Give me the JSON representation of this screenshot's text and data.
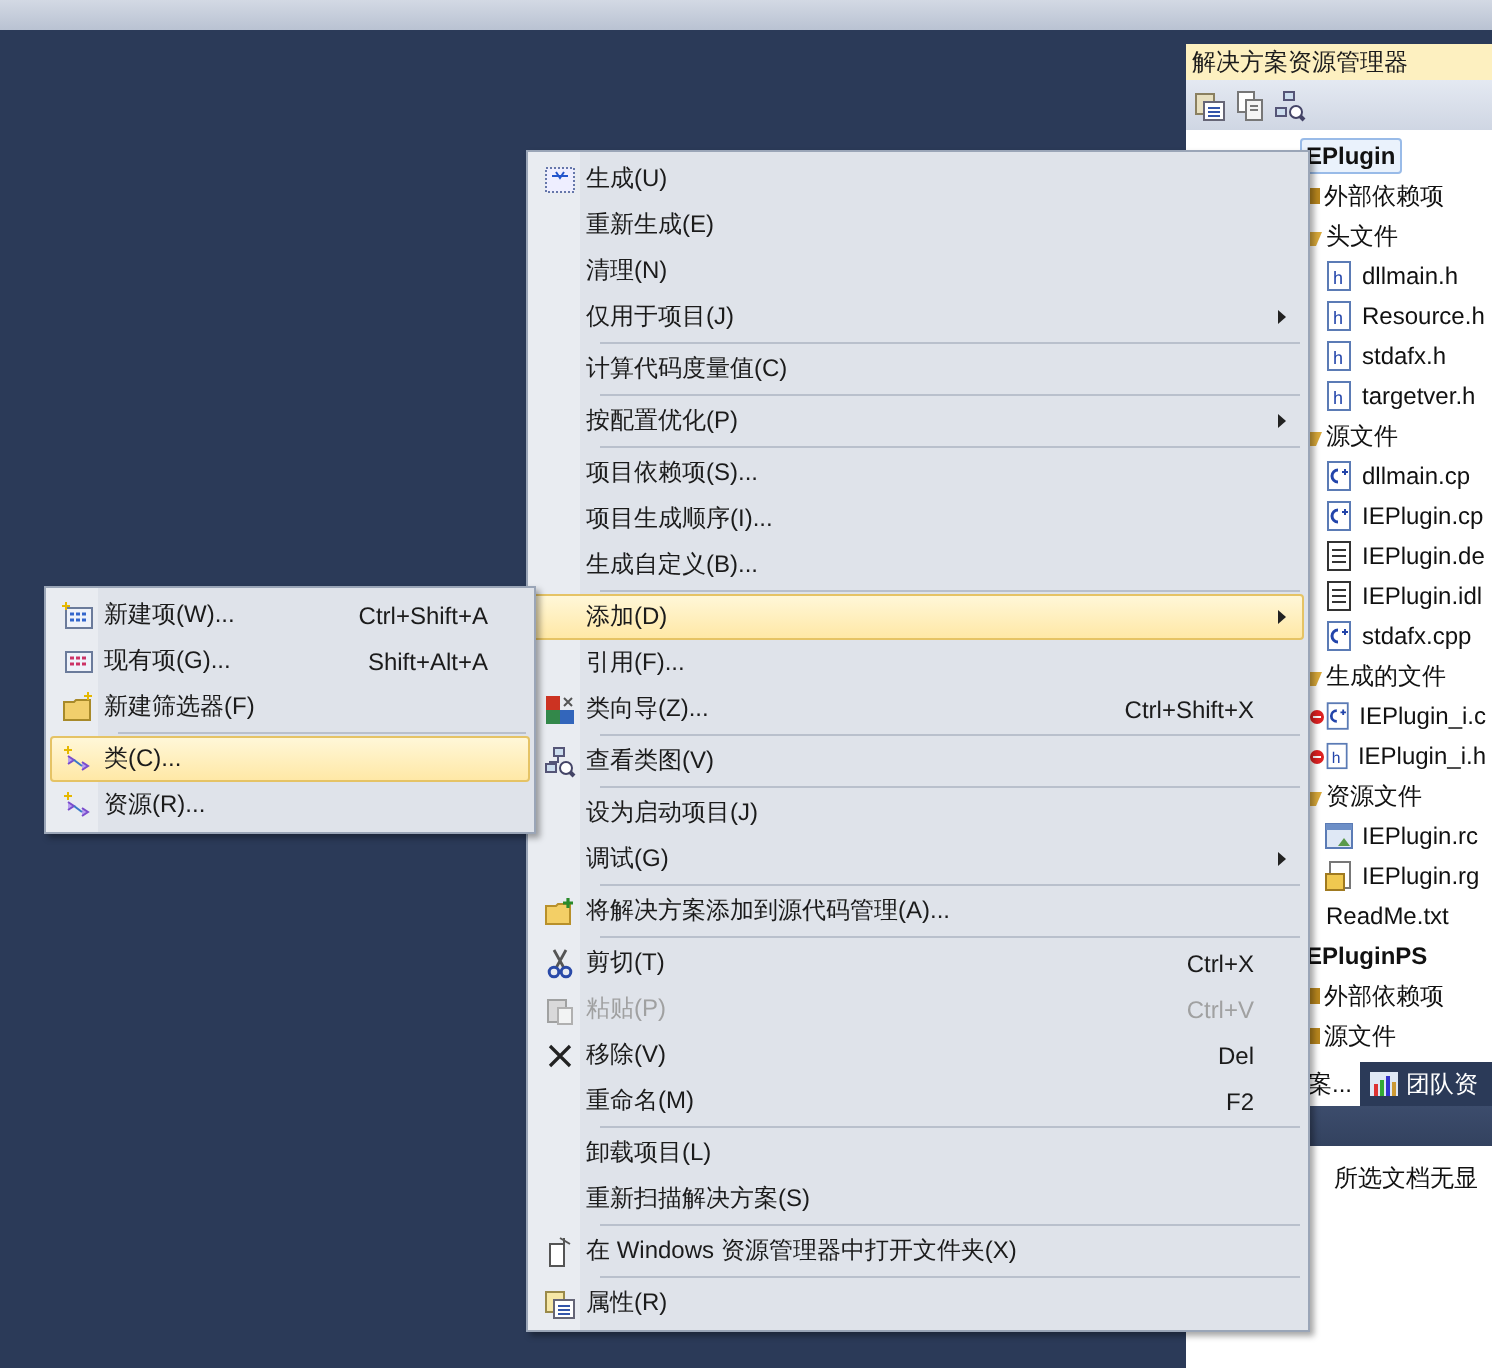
{
  "solution_explorer": {
    "title": "解决方案资源管理器",
    "tree": [
      {
        "kind": "project",
        "label": "EPlugin",
        "selected": true,
        "children": [
          {
            "kind": "folder",
            "label": "外部依赖项",
            "expanded": false
          },
          {
            "kind": "folder",
            "label": "头文件",
            "expanded": true,
            "children": [
              {
                "kind": "h",
                "label": "dllmain.h",
                "error": false
              },
              {
                "kind": "h",
                "label": "Resource.h",
                "error": false
              },
              {
                "kind": "h",
                "label": "stdafx.h",
                "error": false
              },
              {
                "kind": "h",
                "label": "targetver.h",
                "error": false
              }
            ]
          },
          {
            "kind": "folder",
            "label": "源文件",
            "expanded": true,
            "children": [
              {
                "kind": "cpp",
                "label": "dllmain.cp",
                "error": false
              },
              {
                "kind": "cpp",
                "label": "IEPlugin.cp",
                "error": false
              },
              {
                "kind": "text",
                "label": "IEPlugin.de",
                "error": false
              },
              {
                "kind": "text",
                "label": "IEPlugin.idl",
                "error": false
              },
              {
                "kind": "cpp",
                "label": "stdafx.cpp",
                "error": false
              }
            ]
          },
          {
            "kind": "folder",
            "label": "生成的文件",
            "expanded": true,
            "children": [
              {
                "kind": "cpp",
                "label": "IEPlugin_i.c",
                "error": true
              },
              {
                "kind": "h",
                "label": "IEPlugin_i.h",
                "error": true
              }
            ]
          },
          {
            "kind": "folder",
            "label": "资源文件",
            "expanded": true,
            "children": [
              {
                "kind": "rc",
                "label": "IEPlugin.rc",
                "error": false
              },
              {
                "kind": "rgs",
                "label": "IEPlugin.rg",
                "error": false
              }
            ]
          },
          {
            "kind": "plain",
            "label": "ReadMe.txt"
          }
        ]
      },
      {
        "kind": "project",
        "label": "EPluginPS",
        "selected": false,
        "children": [
          {
            "kind": "folder",
            "label": "外部依赖项",
            "expanded": false
          },
          {
            "kind": "folder",
            "label": "源文件",
            "expanded": false
          }
        ]
      }
    ],
    "tabs": [
      {
        "label": "案...",
        "selected": true,
        "icon": false
      },
      {
        "label": "团队资",
        "selected": false,
        "icon": true
      }
    ]
  },
  "status_panel": {
    "text": "所选文档无显"
  },
  "context_menu": {
    "items": [
      {
        "kind": "build",
        "label": "生成(U)",
        "submenu": false,
        "selected": false,
        "disabled": false
      },
      {
        "kind": "plain",
        "label": "重新生成(E)",
        "submenu": false,
        "selected": false,
        "disabled": false
      },
      {
        "kind": "plain",
        "label": "清理(N)",
        "submenu": false,
        "selected": false,
        "disabled": false
      },
      {
        "kind": "plain",
        "label": "仅用于项目(J)",
        "submenu": true,
        "selected": false,
        "disabled": false
      },
      {
        "kind": "separator"
      },
      {
        "kind": "plain",
        "label": "计算代码度量值(C)",
        "submenu": false,
        "selected": false,
        "disabled": false
      },
      {
        "kind": "separator"
      },
      {
        "kind": "plain",
        "label": "按配置优化(P)",
        "submenu": true,
        "selected": false,
        "disabled": false
      },
      {
        "kind": "separator"
      },
      {
        "kind": "plain",
        "label": "项目依赖项(S)...",
        "submenu": false,
        "selected": false,
        "disabled": false
      },
      {
        "kind": "plain",
        "label": "项目生成顺序(I)...",
        "submenu": false,
        "selected": false,
        "disabled": false
      },
      {
        "kind": "plain",
        "label": "生成自定义(B)...",
        "submenu": false,
        "selected": false,
        "disabled": false
      },
      {
        "kind": "separator"
      },
      {
        "kind": "plain",
        "label": "添加(D)",
        "submenu": true,
        "selected": true,
        "disabled": false
      },
      {
        "kind": "plain",
        "label": "引用(F)...",
        "submenu": false,
        "selected": false,
        "disabled": false
      },
      {
        "kind": "wizard",
        "label": "类向导(Z)...",
        "shortcut": "Ctrl+Shift+X",
        "submenu": false,
        "selected": false,
        "disabled": false
      },
      {
        "kind": "separator"
      },
      {
        "kind": "diagram",
        "label": "查看类图(V)",
        "submenu": false,
        "selected": false,
        "disabled": false
      },
      {
        "kind": "separator"
      },
      {
        "kind": "plain",
        "label": "设为启动项目(J)",
        "submenu": false,
        "selected": false,
        "disabled": false
      },
      {
        "kind": "plain",
        "label": "调试(G)",
        "submenu": true,
        "selected": false,
        "disabled": false
      },
      {
        "kind": "separator"
      },
      {
        "kind": "folder-add",
        "label": "将解决方案添加到源代码管理(A)...",
        "submenu": false,
        "selected": false,
        "disabled": false
      },
      {
        "kind": "separator"
      },
      {
        "kind": "cut",
        "label": "剪切(T)",
        "shortcut": "Ctrl+X",
        "submenu": false,
        "selected": false,
        "disabled": false
      },
      {
        "kind": "paste",
        "label": "粘贴(P)",
        "shortcut": "Ctrl+V",
        "submenu": false,
        "selected": false,
        "disabled": true
      },
      {
        "kind": "remove",
        "label": "移除(V)",
        "shortcut": "Del",
        "submenu": false,
        "selected": false,
        "disabled": false
      },
      {
        "kind": "plain",
        "label": "重命名(M)",
        "shortcut": "F2",
        "submenu": false,
        "selected": false,
        "disabled": false
      },
      {
        "kind": "separator"
      },
      {
        "kind": "plain",
        "label": "卸载项目(L)",
        "submenu": false,
        "selected": false,
        "disabled": false
      },
      {
        "kind": "plain",
        "label": "重新扫描解决方案(S)",
        "submenu": false,
        "selected": false,
        "disabled": false
      },
      {
        "kind": "separator"
      },
      {
        "kind": "page",
        "label": "在 Windows 资源管理器中打开文件夹(X)",
        "submenu": false,
        "selected": false,
        "disabled": false
      },
      {
        "kind": "separator"
      },
      {
        "kind": "properties",
        "label": "属性(R)",
        "submenu": false,
        "selected": false,
        "disabled": false
      }
    ]
  },
  "add_submenu": {
    "items": [
      {
        "kind": "new-item",
        "label": "新建项(W)...",
        "shortcut": "Ctrl+Shift+A",
        "selected": false
      },
      {
        "kind": "item",
        "label": "现有项(G)...",
        "shortcut": "Shift+Alt+A",
        "selected": false
      },
      {
        "kind": "filter",
        "label": "新建筛选器(F)",
        "selected": false
      },
      {
        "kind": "separator"
      },
      {
        "kind": "class",
        "label": "类(C)...",
        "selected": true
      },
      {
        "kind": "class",
        "label": "资源(R)...",
        "selected": false
      }
    ]
  }
}
